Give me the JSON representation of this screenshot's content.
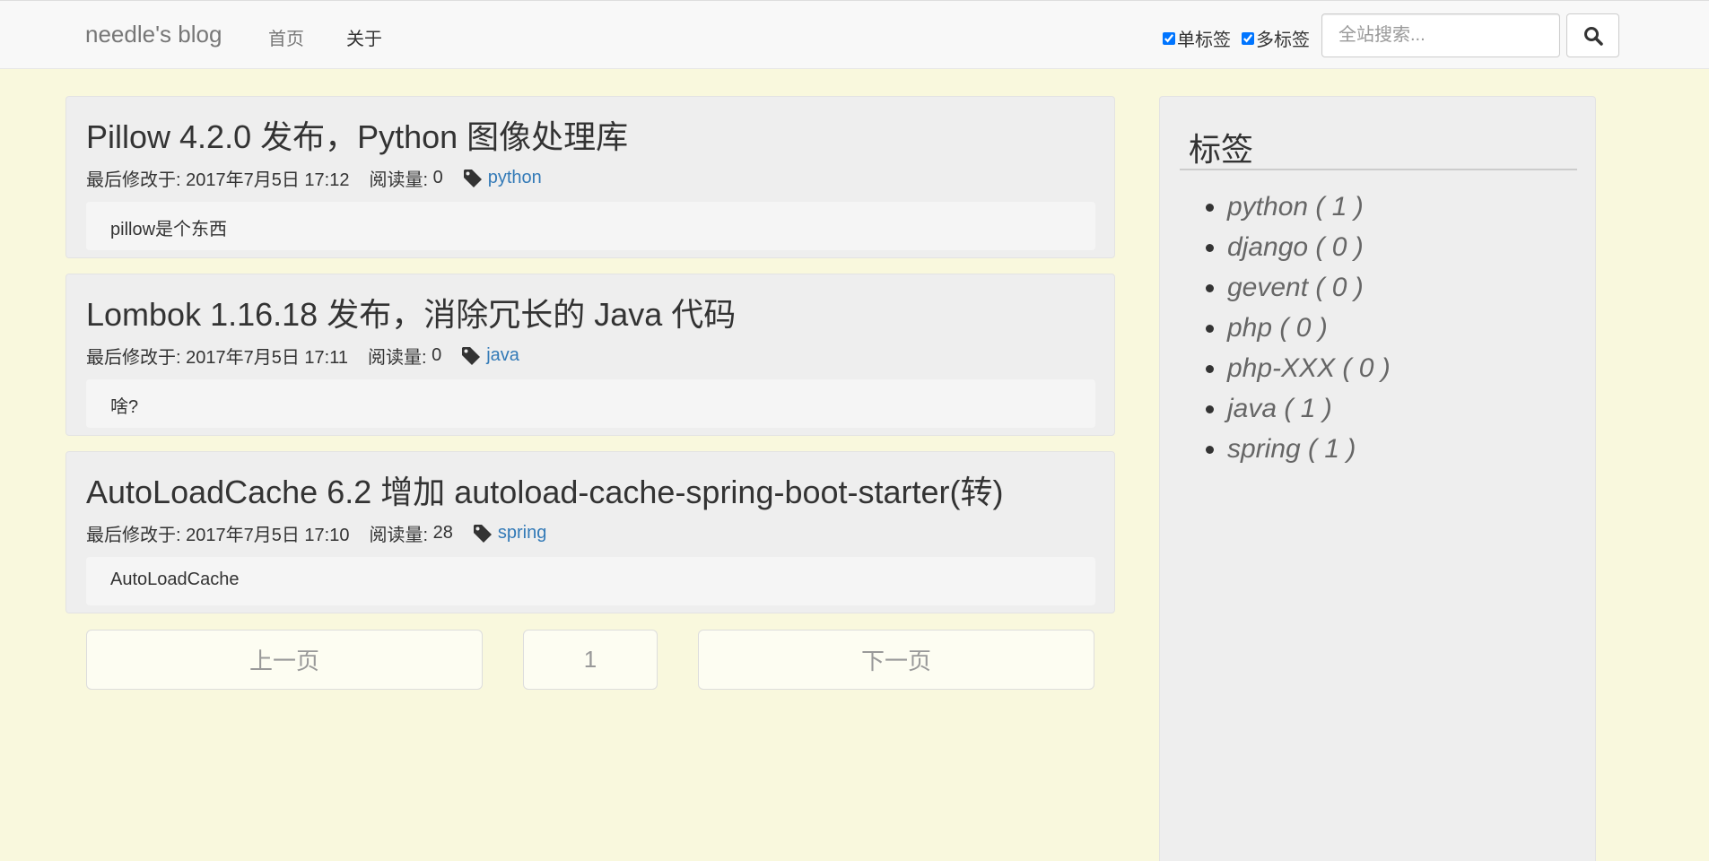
{
  "navbar": {
    "brand": "needle's blog",
    "links": [
      {
        "label": "首页"
      },
      {
        "label": "关于"
      }
    ],
    "single_tag_label": "单标签",
    "multi_tag_label": "多标签",
    "single_tag_checked": true,
    "multi_tag_checked": true,
    "search_placeholder": "全站搜索...",
    "search_icon": "search-icon"
  },
  "articles": [
    {
      "title": "Pillow 4.2.0 发布，Python 图像处理库",
      "modified_label": "最后修改于:",
      "modified": "2017年7月5日 17:12",
      "views_label": "阅读量:",
      "views": "0",
      "tag": "python",
      "excerpt": "pillow是个东西"
    },
    {
      "title": "Lombok 1.16.18 发布，消除冗长的 Java 代码",
      "modified_label": "最后修改于:",
      "modified": "2017年7月5日 17:11",
      "views_label": "阅读量:",
      "views": "0",
      "tag": "java",
      "excerpt": "啥?"
    },
    {
      "title": "AutoLoadCache 6.2 增加 autoload-cache-spring-boot-starter(转)",
      "modified_label": "最后修改于:",
      "modified": "2017年7月5日 17:10",
      "views_label": "阅读量:",
      "views": "28",
      "tag": "spring",
      "excerpt": "AutoLoadCache"
    }
  ],
  "pager": {
    "prev": "上一页",
    "current": "1",
    "next": "下一页"
  },
  "sidebar": {
    "title": "标签",
    "tags": [
      {
        "label": "python ( 1 )"
      },
      {
        "label": "django ( 0 )"
      },
      {
        "label": "gevent ( 0 )"
      },
      {
        "label": "php ( 0 )"
      },
      {
        "label": "php-XXX ( 0 )"
      },
      {
        "label": "java ( 1 )"
      },
      {
        "label": "spring ( 1 )"
      }
    ]
  },
  "colors": {
    "page_background": "#f9f8dd",
    "link": "#337ab7",
    "panel": "#eeeeee"
  }
}
